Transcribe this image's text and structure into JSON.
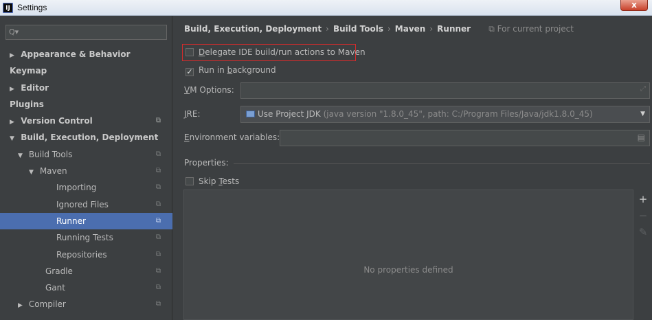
{
  "window": {
    "title": "Settings",
    "app_icon": "IJ",
    "close_glyph": "x"
  },
  "search": {
    "icon": "search-icon",
    "glyph": "Q▾"
  },
  "sidebar": {
    "items": [
      {
        "label": "Appearance & Behavior",
        "arrow": "▶",
        "bold": true,
        "indent": 0
      },
      {
        "label": "Keymap",
        "arrow": "",
        "bold": true,
        "indent": 0
      },
      {
        "label": "Editor",
        "arrow": "▶",
        "bold": true,
        "indent": 0
      },
      {
        "label": "Plugins",
        "arrow": "",
        "bold": true,
        "indent": 0
      },
      {
        "label": "Version Control",
        "arrow": "▶",
        "bold": true,
        "indent": 0,
        "proj": true
      },
      {
        "label": "Build, Execution, Deployment",
        "arrow": "▼",
        "bold": true,
        "indent": 0
      },
      {
        "label": "Build Tools",
        "arrow": "▼",
        "bold": false,
        "indent": 1,
        "proj": true
      },
      {
        "label": "Maven",
        "arrow": "▼",
        "bold": false,
        "indent": 2,
        "proj": true
      },
      {
        "label": "Importing",
        "arrow": "",
        "bold": false,
        "indent": 3,
        "proj": true
      },
      {
        "label": "Ignored Files",
        "arrow": "",
        "bold": false,
        "indent": 3,
        "proj": true
      },
      {
        "label": "Runner",
        "arrow": "",
        "bold": false,
        "indent": 3,
        "proj": true,
        "selected": true
      },
      {
        "label": "Running Tests",
        "arrow": "",
        "bold": false,
        "indent": 3,
        "proj": true
      },
      {
        "label": "Repositories",
        "arrow": "",
        "bold": false,
        "indent": 3,
        "proj": true
      },
      {
        "label": "Gradle",
        "arrow": "",
        "bold": false,
        "indent": 2,
        "proj": true
      },
      {
        "label": "Gant",
        "arrow": "",
        "bold": false,
        "indent": 2,
        "proj": true
      },
      {
        "label": "Compiler",
        "arrow": "▶",
        "bold": false,
        "indent": 1,
        "proj": true
      }
    ],
    "proj_glyph": "⧉"
  },
  "breadcrumb": {
    "parts": [
      "Build, Execution, Deployment",
      "Build Tools",
      "Maven",
      "Runner"
    ],
    "sep": "›",
    "for_project": "⧉ For current project"
  },
  "options": {
    "delegate": {
      "label": "Delegate IDE build/run actions to Maven",
      "mnemonic": "D",
      "checked": false
    },
    "background": {
      "label_pre": "Run in ",
      "mnemonic": "b",
      "label_post": "ackground",
      "checked": true
    }
  },
  "vm_options": {
    "mnemonic": "V",
    "label_rest": "M Options:",
    "value": ""
  },
  "jre": {
    "mnemonic": "J",
    "label_rest": "RE:",
    "selected": "Use Project JDK",
    "detail": "(java version \"1.8.0_45\", path: C:/Program Files/Java/jdk1.8.0_45)"
  },
  "env_vars": {
    "mnemonic": "E",
    "label_rest": "nvironment variables:",
    "value": ""
  },
  "properties": {
    "label": "Properties:",
    "skip_tests": {
      "label_pre": "Skip ",
      "mnemonic": "T",
      "label_post": "ests",
      "checked": false
    },
    "empty_text": "No properties defined",
    "toolbar": {
      "add": "+",
      "remove": "−",
      "edit": "✎"
    }
  },
  "colors": {
    "selection": "#4b6eaf",
    "highlight": "#d62b2b",
    "background": "#3c3f41"
  }
}
